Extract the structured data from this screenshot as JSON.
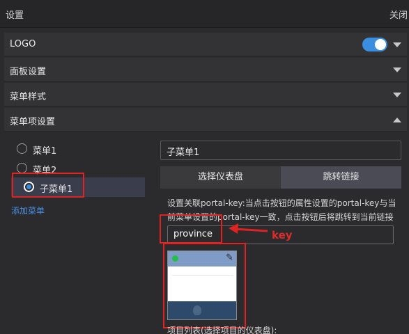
{
  "header": {
    "title": "设置",
    "close_label": "关闭"
  },
  "sections": {
    "logo": {
      "label": "LOGO",
      "toggle_on": true
    },
    "panel": {
      "label": "面板设置"
    },
    "menu_style": {
      "label": "菜单样式"
    },
    "menu_item": {
      "label": "菜单项设置"
    }
  },
  "menu_items": [
    {
      "label": "菜单1",
      "checked": false
    },
    {
      "label": "菜单2",
      "checked": false
    },
    {
      "label": "子菜单1",
      "checked": true
    }
  ],
  "add_menu_label": "添加菜单",
  "selected_item": {
    "name": "子菜单1",
    "tabs": [
      {
        "label": "选择仪表盘",
        "active": true
      },
      {
        "label": "跳转链接",
        "active": false
      }
    ],
    "description": "设置关联portal-key:当点击按钮的属性设置的portal-key与当前菜单设置的portal-key一致，点击按钮后将跳转到当前链接",
    "portal_key": "province",
    "dashboard_list_label": "项目列表(选择项目的仪表盘):"
  },
  "annotation": {
    "text": "key",
    "color": "#e02a2a"
  },
  "colors": {
    "accent": "#3b8de0",
    "link": "#4a90e2",
    "annotation": "#e02222"
  }
}
